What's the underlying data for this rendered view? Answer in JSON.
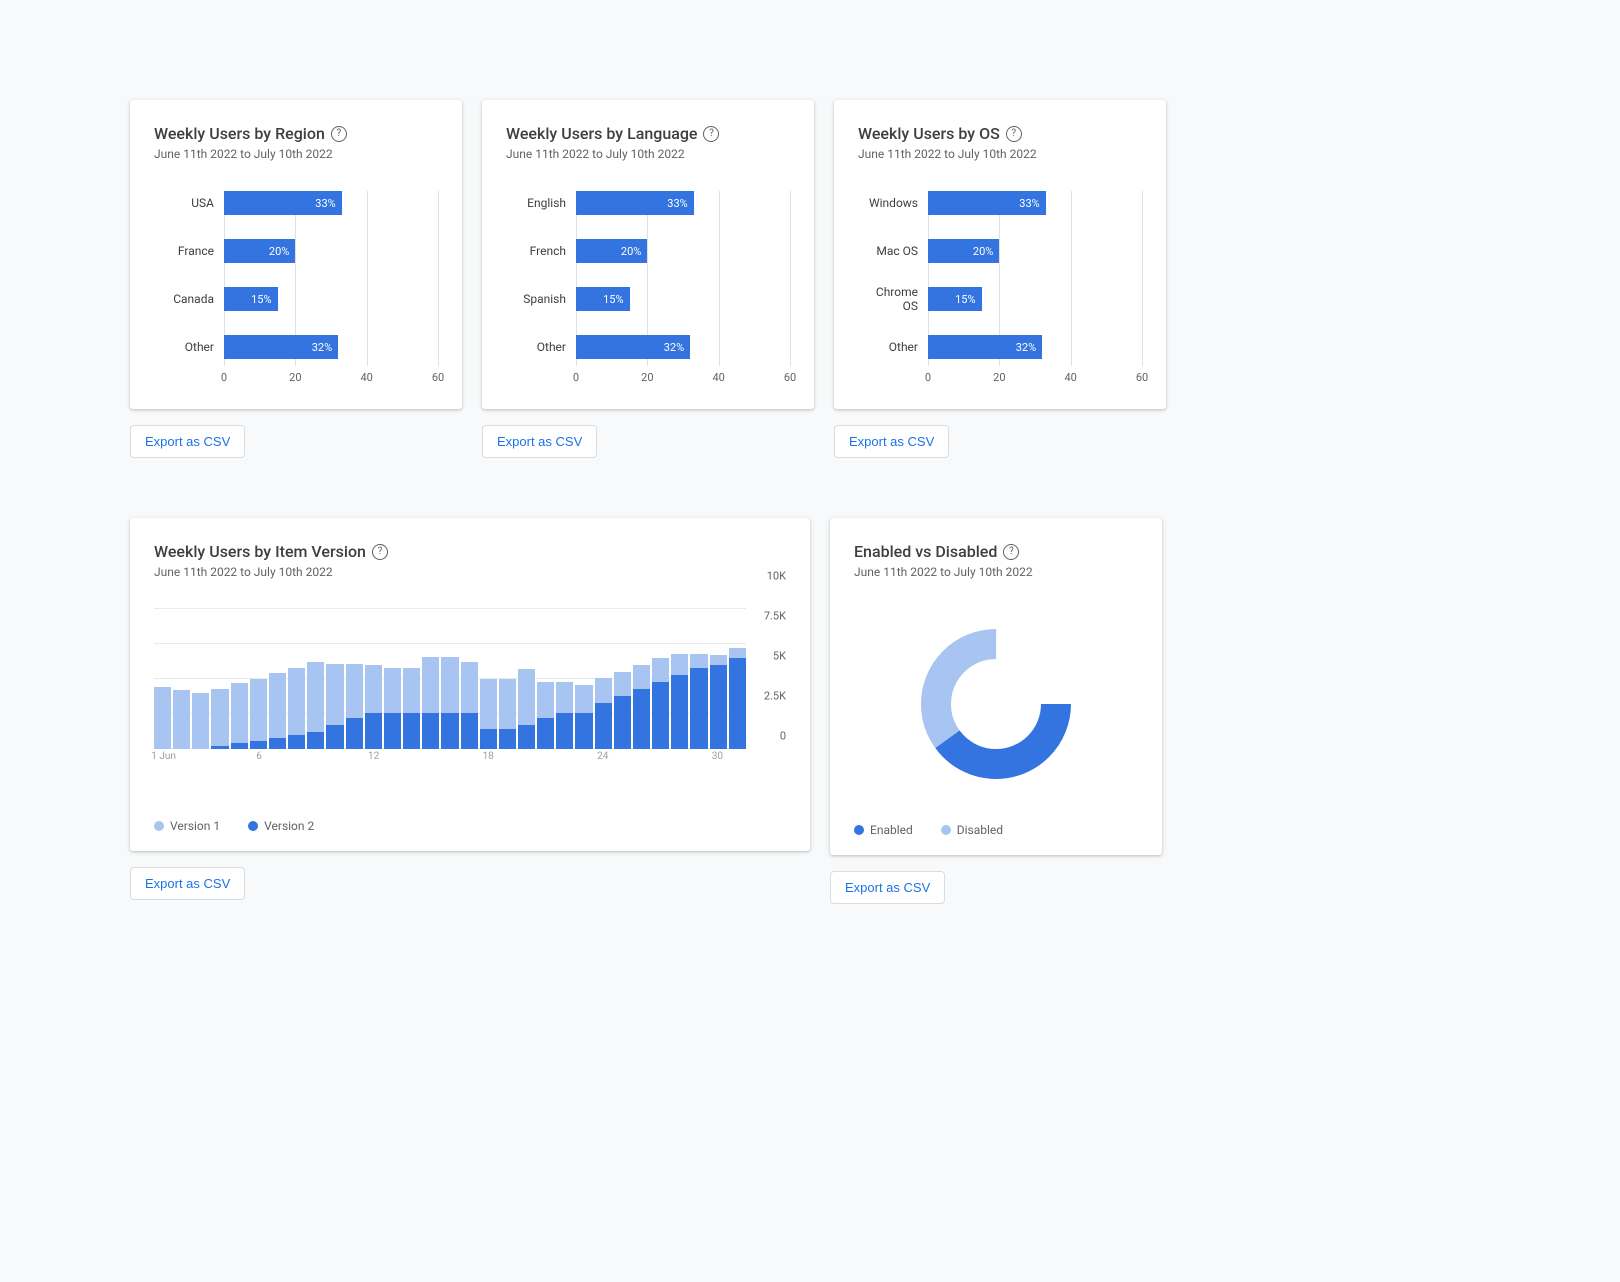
{
  "export_label": "Export as CSV",
  "cards": {
    "region": {
      "title": "Weekly Users by Region",
      "subtitle": "June 11th 2022 to July 10th 2022"
    },
    "language": {
      "title": "Weekly Users by Language",
      "subtitle": "June 11th 2022 to July 10th 2022"
    },
    "os": {
      "title": "Weekly Users by OS",
      "subtitle": "June 11th 2022 to July 10th 2022"
    },
    "version": {
      "title": "Weekly Users by Item Version",
      "subtitle": "June 11th 2022 to July 10th 2022"
    },
    "enabled": {
      "title": "Enabled vs Disabled",
      "subtitle": "June 11th 2022 to July 10th 2022"
    }
  },
  "legend": {
    "version1": "Version 1",
    "version2": "Version 2",
    "enabled": "Enabled",
    "disabled": "Disabled"
  },
  "colors": {
    "primary": "#3374e0",
    "light": "#a8c4f0"
  },
  "chart_data": [
    {
      "id": "region",
      "type": "bar",
      "orientation": "horizontal",
      "categories": [
        "USA",
        "France",
        "Canada",
        "Other"
      ],
      "values": [
        33,
        20,
        15,
        32
      ],
      "value_labels": [
        "33%",
        "20%",
        "15%",
        "32%"
      ],
      "xticks": [
        0,
        20,
        40,
        60
      ],
      "xlim": [
        0,
        60
      ]
    },
    {
      "id": "language",
      "type": "bar",
      "orientation": "horizontal",
      "categories": [
        "English",
        "French",
        "Spanish",
        "Other"
      ],
      "values": [
        33,
        20,
        15,
        32
      ],
      "value_labels": [
        "33%",
        "20%",
        "15%",
        "32%"
      ],
      "xticks": [
        0,
        20,
        40,
        60
      ],
      "xlim": [
        0,
        60
      ]
    },
    {
      "id": "os",
      "type": "bar",
      "orientation": "horizontal",
      "categories": [
        "Windows",
        "Mac OS",
        "Chrome OS",
        "Other"
      ],
      "values": [
        33,
        20,
        15,
        32
      ],
      "value_labels": [
        "33%",
        "20%",
        "15%",
        "32%"
      ],
      "xticks": [
        0,
        20,
        40,
        60
      ],
      "xlim": [
        0,
        60
      ]
    },
    {
      "id": "version",
      "type": "bar",
      "orientation": "vertical-stacked",
      "x_labels": [
        "1 Jun",
        "",
        "",
        "",
        "",
        "6",
        "",
        "",
        "",
        "",
        "",
        "12",
        "",
        "",
        "",
        "",
        "",
        "18",
        "",
        "",
        "",
        "",
        "",
        "24",
        "",
        "",
        "",
        "",
        "",
        "30",
        ""
      ],
      "series": [
        {
          "name": "Version 2",
          "color": "#3374e0",
          "values": [
            0,
            0,
            0,
            200,
            400,
            600,
            800,
            1000,
            1200,
            1700,
            2200,
            2600,
            2600,
            2600,
            2600,
            2600,
            2600,
            1400,
            1400,
            1700,
            2200,
            2600,
            2600,
            3300,
            3800,
            4300,
            4800,
            5300,
            5800,
            6000,
            6500
          ]
        },
        {
          "name": "Version 1",
          "color": "#a8c4f0",
          "values": [
            4400,
            4200,
            4000,
            4100,
            4300,
            4400,
            4600,
            4800,
            5000,
            4400,
            3900,
            3400,
            3200,
            3200,
            4000,
            4000,
            3600,
            3600,
            3600,
            4000,
            2600,
            2200,
            2000,
            1800,
            1700,
            1700,
            1700,
            1500,
            1000,
            700,
            700
          ]
        }
      ],
      "yticks": [
        0,
        2500,
        5000,
        7500,
        10000
      ],
      "ytick_labels": [
        "0",
        "2.5K",
        "5K",
        "7.5K",
        "10K"
      ],
      "ylim": [
        0,
        10000
      ]
    },
    {
      "id": "enabled",
      "type": "pie",
      "donut": true,
      "categories": [
        "Enabled",
        "Disabled"
      ],
      "values": [
        65,
        35
      ],
      "colors": [
        "#3374e0",
        "#a8c4f0"
      ]
    }
  ]
}
